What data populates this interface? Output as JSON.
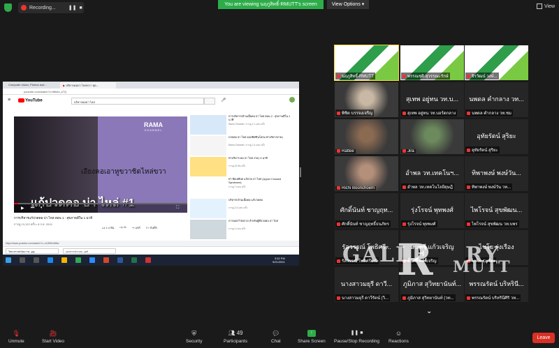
{
  "topbar": {
    "recording_label": "Recording...",
    "viewing_banner": "You are viewing นฤภูสิทธิ์-RMUTT's screen",
    "view_options": "View Options",
    "view_label": "View"
  },
  "browser": {
    "tabs": [
      "Computer vision, Photos and...",
      "บริหารคอบ่า ไหล่ขวา ชุด..."
    ],
    "url": "youtube.com/watch?v=l5tk8n_k7Q",
    "search_value": "บริหารคอบ่า ไหล่"
  },
  "youtube": {
    "logo": "YouTube",
    "channel_top": "RAMA",
    "channel_bottom": "CHANNEL",
    "subtitle": "เอียงคอเอาหูขวาชิดไหล่ขวา",
    "big_title": "แก้ปวดคอ บ่า ไหล่ #1",
    "video_title": "การบริหารแก้ปวดคอ บ่า ไหล่ ตอน 1 : สุขภาพดีใน 1 นาที",
    "video_meta": "การดู 13,122 ครั้ง • 8 ก.ย. 2019",
    "likes": "1.4 พัน",
    "dislikes": "41",
    "share": "แชร์",
    "save": "บันทึก",
    "status_url": "https://www.youtube.com/watch?v=-n1W9Kc58lw"
  },
  "sidebar_videos": [
    {
      "title": "การบริหารกล้ามเนื้อคอ บ่า ไหล่ ตอน 2 : สุขภาพดีใน 1 นาที",
      "meta": "Rama Channel • การดู 1.1 แสน ครั้ง"
    },
    {
      "title": "ปวดคอ บ่า ไหล่ ออฟฟิศซินโดรม ท่าบริหารง่ายๆ",
      "meta": "Rama Channel • การดู 1.4 แสน ครั้ง"
    },
    {
      "title": "ท่าบริหาร คอ บ่า ไหล่ ง่ายๆ 5 นาที",
      "meta": "การดู 42 พัน ครั้ง"
    },
    {
      "title": "ท่า ยืดเหยียด แก้ปวด บ่า ไหล่ (Upper Crossed Syndrome)",
      "meta": "การดู 7 แสน ครั้ง"
    },
    {
      "title": "บริหารกล้ามเนื้อคอ แก้ปวดคอ",
      "meta": "การดู 2.4 แสน ครั้ง"
    },
    {
      "title": "การออกกำลังกาย สำหรับผู้ที่ปวดคอ บ่า ไหล่",
      "meta": "การดู 1 แสน ครั้ง"
    }
  ],
  "downloads": [
    "วิทยาศาสตร์สุขภาพ...jpg",
    "เอกสารประกอบ...pdf"
  ],
  "taskbar_time": "3:52 PM",
  "taskbar_date": "9/21/2021",
  "participants": [
    {
      "big": "",
      "label": "นฤภูสิทธิ์-RMUTT",
      "kind": "slide",
      "active": true
    },
    {
      "big": "",
      "label": "พรรณชุติ สุวรรณะรักษ์",
      "kind": "slide"
    },
    {
      "big": "",
      "label": "จิรวัฒน์ วงษ์...",
      "kind": "slide"
    },
    {
      "big": "",
      "label": "พิชิต บรรจงเจริญ",
      "kind": "cam"
    },
    {
      "big": "สุเทพ อยู่ทน วท.บ...",
      "label": "สุเทพ อยู่ทน วท.บอร์ดกลาง"
    },
    {
      "big": "นพดล คำกลาง วท...",
      "label": "นพดล คำกลาง วท.ชม"
    },
    {
      "big": "",
      "label": "Rattee",
      "kind": "cam"
    },
    {
      "big": "",
      "label": "Jira",
      "kind": "cam"
    },
    {
      "big": "อุทัยรัตน์ สุริยะ",
      "label": "อุทัยรัตน์ สุริยะ"
    },
    {
      "big": "",
      "label": "Richi Boonchoem",
      "kind": "cam"
    },
    {
      "big": "อำพล วท.เทคโนฯ...",
      "label": "อำพล วท.เทคโนโลยีดุษฎี"
    },
    {
      "big": "ทิพาพงษ์ พงษ์วัน...",
      "label": "ทิพาพงษ์ พงษ์วัน วท..."
    },
    {
      "big": "ศักดิ์นันท์ ชาญฤท...",
      "label": "ศักดิ์นันท์ ชาญฤทธิ์ธนภัทร"
    },
    {
      "big": "รุ่งโรจน์ พุทพงศ์",
      "label": "รุ่งโรจน์ พุทพงศ์"
    },
    {
      "big": "ไพโรจน์ สุขพัฒน...",
      "label": "ไพโรจน์ สุขพัฒน วท.บพร"
    },
    {
      "big": "รัลวรรณ์ โพธิศรี...",
      "label": "รัลวรรณ์ โพธิศรีมณี"
    },
    {
      "big": "มนตรี แก้วเจริญ",
      "label": "มนตรี แก้วเจริญ"
    },
    {
      "big": "ไชโย รุ่งเรือง",
      "label": "ไชโย รุ่งเรือง"
    },
    {
      "big": "นางสาวมยุรี ดาวี...",
      "label": "นางสาวมยุรี ดาวีรัตน์ (วิ..."
    },
    {
      "big": "ภูมิภาส สุวิทยานันท์...",
      "label": "ภูมิภาส สุวิทยานันท์ (วท..."
    },
    {
      "big": "พรรณรัตน์ บริหรินี...",
      "label": "พรรณรัตน์ บริหรินีศิริ วท..."
    }
  ],
  "watermark": {
    "left": "GALLE",
    "right": "RY",
    "sub": "MUTT"
  },
  "toolbar": {
    "unmute": "Unmute",
    "start_video": "Start Video",
    "security": "Security",
    "participants": "Participants",
    "participants_count": "49",
    "chat": "Chat",
    "share_screen": "Share Screen",
    "record": "Pause/Stop Recording",
    "reactions": "Reactions",
    "leave": "Leave"
  },
  "colors": {
    "zoom_green": "#2dad4a",
    "leave_red": "#d93025",
    "yt_red": "#ff0000",
    "active_outline": "#f2d33a"
  }
}
